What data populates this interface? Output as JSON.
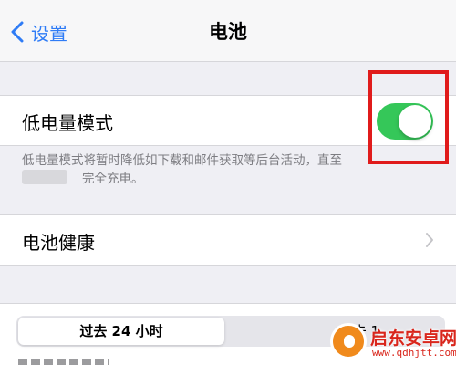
{
  "nav": {
    "back_label": "设置",
    "title": "电池"
  },
  "low_power": {
    "label": "低电量模式",
    "enabled": true,
    "description_line1": "低电量模式将暂时降低如下载和邮件获取等后台活动，直至",
    "description_line2": "完全充电。"
  },
  "battery_health": {
    "label": "电池健康"
  },
  "usage_tabs": {
    "selected": "过去 24 小时",
    "other": "过去 1"
  },
  "watermark": {
    "title": "启东安卓网",
    "url": "www.qdhjtt.com"
  },
  "colors": {
    "accent": "#2f7cf6",
    "toggle_on": "#35c759",
    "highlight": "#e01b1b"
  },
  "icons": [
    "chevron-left-icon",
    "chevron-right-icon"
  ]
}
